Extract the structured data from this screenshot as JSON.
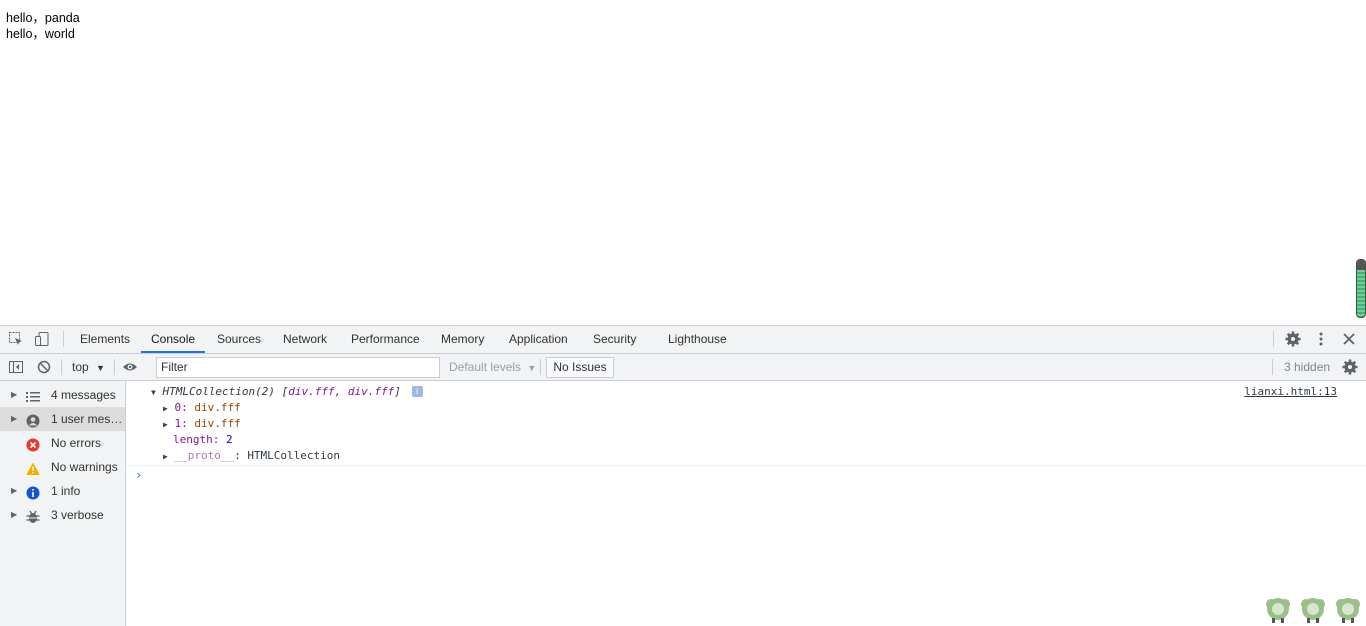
{
  "page": {
    "lines": [
      "hello，panda",
      "hello，world"
    ]
  },
  "devtools": {
    "tabs": [
      "Elements",
      "Console",
      "Sources",
      "Network",
      "Performance",
      "Memory",
      "Application",
      "Security",
      "Lighthouse"
    ],
    "active_tab": "Console",
    "toolbar": {
      "context": "top",
      "filter_placeholder": "Filter",
      "levels": "Default levels",
      "issues": "No Issues",
      "hidden": "3 hidden"
    },
    "sidebar": [
      {
        "label": "4 messages",
        "icon": "list-icon",
        "expandable": true
      },
      {
        "label": "1 user mess...",
        "icon": "user-icon",
        "expandable": true,
        "selected": true
      },
      {
        "label": "No errors",
        "icon": "error-icon",
        "expandable": false
      },
      {
        "label": "No warnings",
        "icon": "warning-icon",
        "expandable": false
      },
      {
        "label": "1 info",
        "icon": "info-icon",
        "expandable": true
      },
      {
        "label": "3 verbose",
        "icon": "bug-icon",
        "expandable": true
      }
    ],
    "console": {
      "source": "lianxi.html:13",
      "header": {
        "name": "HTMLCollection(2)",
        "preview_open": "[",
        "preview_items": [
          "div.fff",
          "div.fff"
        ],
        "preview_sep": ", ",
        "preview_close": "]",
        "info_badge": "i"
      },
      "entries": [
        {
          "key": "0",
          "value": "div.fff",
          "expandable": true
        },
        {
          "key": "1",
          "value": "div.fff",
          "expandable": true
        },
        {
          "key": "length",
          "value": "2",
          "expandable": false
        },
        {
          "key": "__proto__",
          "value": "HTMLCollection",
          "expandable": true
        }
      ],
      "prompt_symbol": "›"
    }
  },
  "colors": {
    "accent": "#1a73e8",
    "toolbar_bg": "#f1f3f4",
    "error": "#e53935",
    "warning": "#f9ab00",
    "info": "#1a53c9"
  }
}
